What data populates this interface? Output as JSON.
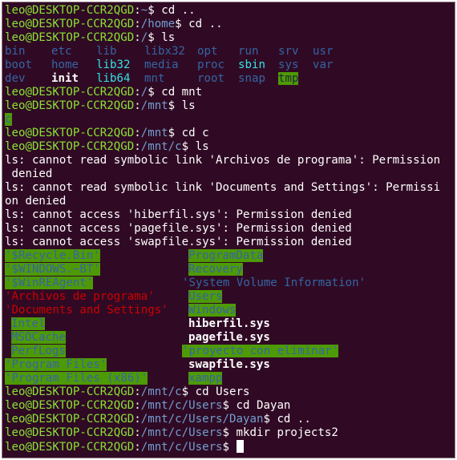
{
  "prompt_user": "leo@DESKTOP-CCR2QGD",
  "history": [
    {
      "path": "~",
      "cmd": "cd .."
    },
    {
      "path": "/home",
      "cmd": "cd .."
    },
    {
      "path": "/",
      "cmd": "ls"
    }
  ],
  "root_listing": [
    [
      "bin",
      "etc",
      "lib",
      "libx32",
      "opt",
      "run",
      "srv",
      "usr"
    ],
    [
      "boot",
      "home",
      "lib32",
      "media",
      "proc",
      "sbin",
      "sys",
      "var"
    ],
    [
      "dev",
      "init",
      "lib64",
      "mnt",
      "root",
      "snap",
      "tmp",
      ""
    ]
  ],
  "history2": [
    {
      "path": "/",
      "cmd": "cd mnt"
    },
    {
      "path": "/mnt",
      "cmd": "ls"
    }
  ],
  "mnt_listing": "c",
  "history3": [
    {
      "path": "/mnt",
      "cmd": "cd c"
    },
    {
      "path": "/mnt/c",
      "cmd": "ls"
    }
  ],
  "errors": [
    "ls: cannot read symbolic link 'Archivos de programa': Permission",
    " denied",
    "ls: cannot read symbolic link 'Documents and Settings': Permissi",
    "on denied",
    "ls: cannot access 'hiberfil.sys': Permission denied",
    "ls: cannot access 'pagefile.sys': Permission denied",
    "ls: cannot access 'swapfile.sys': Permission denied"
  ],
  "c_listing_left": [
    "'$Recycle.Bin'",
    "'$WINDOWS.~BT'",
    "'$WinREAgent'",
    "'Archivos de programa'",
    "'Documents and Settings'",
    "Intel",
    "MSOCache",
    "PerfLogs",
    "'Program Files'",
    "'Program Files (x86)'"
  ],
  "c_listing_right": [
    "ProgramData",
    "Recovery",
    "'System Volume Information'",
    "Users",
    "Windows",
    "hiberfil.sys",
    "pagefile.sys",
    "'proyecto con eliminar'",
    "swapfile.sys",
    "xampp"
  ],
  "history4": [
    {
      "path": "/mnt/c",
      "cmd": "cd Users"
    },
    {
      "path": "/mnt/c/Users",
      "cmd": "cd Dayan"
    },
    {
      "path": "/mnt/c/Users/Dayan",
      "cmd": "cd .."
    },
    {
      "path": "/mnt/c/Users",
      "cmd": "mkdir projects2"
    }
  ],
  "current": {
    "path": "/mnt/c/Users",
    "cmd": ""
  },
  "colors": {
    "background": "#300a24",
    "user": "#8ae234",
    "path": "#729fcf",
    "dir": "#3465a4",
    "sticky_bg": "#4e9a06",
    "symlink": "#34e2e2",
    "broken": "#cc0000"
  }
}
